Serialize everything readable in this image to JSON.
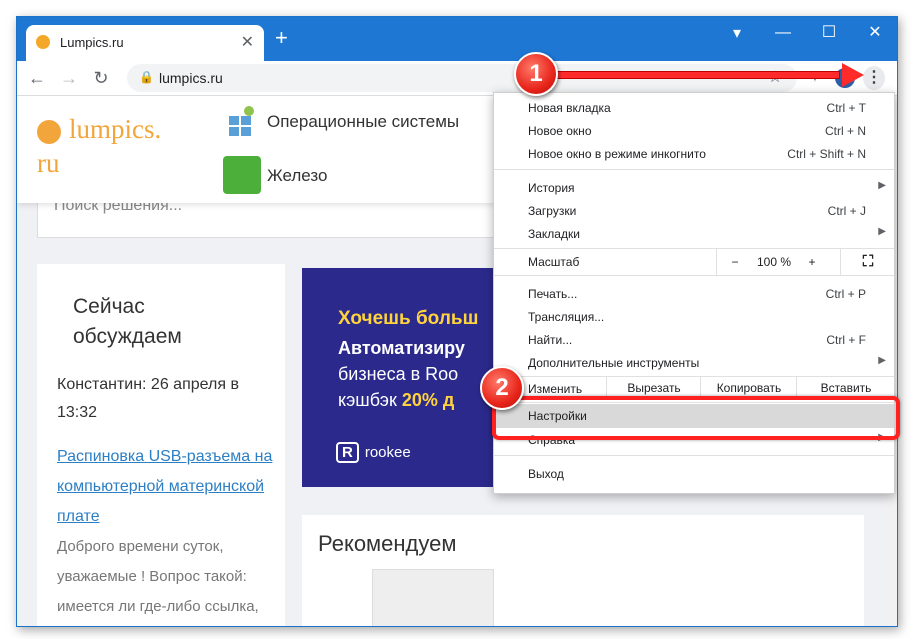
{
  "browser": {
    "tab": {
      "title": "Lumpics.ru",
      "close": "✕"
    },
    "new_tab": "+",
    "window_controls": {
      "minimize": "—",
      "maximize": "☐",
      "close": "✕"
    },
    "address": {
      "url": "lumpics.ru"
    },
    "avatar_letter": "K"
  },
  "site": {
    "logo_line1": "lumpics.",
    "logo_line2": "ru",
    "categories": [
      "Операционные системы",
      "Железо"
    ],
    "search_placeholder": "Поиск решения...",
    "discussion": {
      "title": "Сейчас обсуждаем",
      "author": "Константин: 26 апреля в 13:32",
      "link": "Распиновка USB-разъема на компьютерной материнской плате",
      "text": "Доброго времени суток, уважаемые ! Вопрос такой: имеется ли где-либо ссылка,"
    },
    "banner": {
      "line1": "Хочешь больш",
      "line2": "Автоматизиру",
      "line3": "бизнеса в Roo",
      "line4_prefix": "кэшбэк ",
      "line4_bold": "20% д",
      "logo": "rookee"
    },
    "recommend_title": "Рекомендуем"
  },
  "menu": {
    "items_top": [
      {
        "label": "Новая вкладка",
        "shortcut": "Ctrl + T"
      },
      {
        "label": "Новое окно",
        "shortcut": "Ctrl + N"
      },
      {
        "label": "Новое окно в режиме инкогнито",
        "shortcut": "Ctrl + Shift + N"
      }
    ],
    "history": "История",
    "downloads": {
      "label": "Загрузки",
      "shortcut": "Ctrl + J"
    },
    "bookmarks": "Закладки",
    "zoom": {
      "label": "Масштаб",
      "minus": "−",
      "value": "100 %",
      "plus": "+"
    },
    "print": {
      "label": "Печать...",
      "shortcut": "Ctrl + P"
    },
    "cast": "Трансляция...",
    "find": {
      "label": "Найти...",
      "shortcut": "Ctrl + F"
    },
    "more_tools": "Дополнительные инструменты",
    "edit": {
      "label": "Изменить",
      "cut": "Вырезать",
      "copy": "Копировать",
      "paste": "Вставить"
    },
    "settings": "Настройки",
    "help": "Справка",
    "exit": "Выход"
  },
  "annotations": {
    "step1": "1",
    "step2": "2"
  }
}
